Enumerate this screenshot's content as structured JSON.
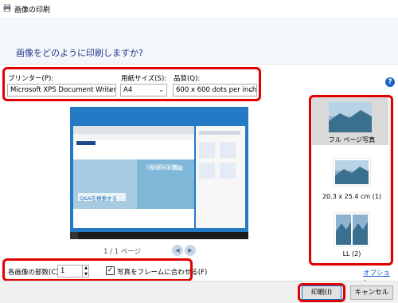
{
  "window": {
    "title": "画像の印刷"
  },
  "header": {
    "question": "画像をどのように印刷しますか?"
  },
  "printer": {
    "label": "プリンター(P):",
    "value": "Microsoft XPS Document Writer"
  },
  "paper": {
    "label": "用紙サイズ(S):",
    "value": "A4"
  },
  "quality": {
    "label": "品質(Q):",
    "value": "600 x 600 dots per inch"
  },
  "help": {
    "glyph": "?"
  },
  "preview": {
    "pages": "1 / 1 ページ",
    "screen": {
      "banner": "サポート情報",
      "search": "Q&Aを検索する"
    }
  },
  "layouts": [
    {
      "label": "フル ページ写真",
      "selected": true
    },
    {
      "label": "20.3 x 25.4 cm (1)",
      "selected": false
    },
    {
      "label": "LL (2)",
      "selected": false
    }
  ],
  "copies": {
    "label": "各画像の部数(C):",
    "value": "1"
  },
  "fit": {
    "label": "写真をフレームに合わせる(F)",
    "checked": true
  },
  "options_link": "オプション...",
  "buttons": {
    "print": "印刷(I)",
    "cancel": "キャンセル"
  },
  "colors": {
    "highlight": "#e00000",
    "link": "#1a64c6",
    "heading": "#1f3a8a"
  }
}
